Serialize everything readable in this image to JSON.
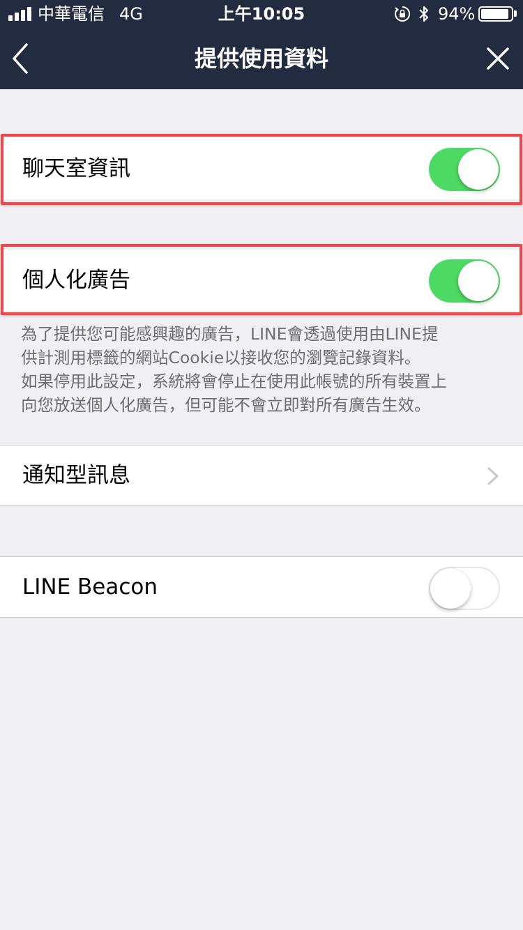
{
  "status_bar": {
    "carrier": "中華電信",
    "network": "4G",
    "time": "上午10:05",
    "battery_percent": "94%",
    "battery_level": 0.94,
    "signal_bars": 4
  },
  "nav": {
    "title": "提供使用資料",
    "back_icon": "chevron-left-icon",
    "close_icon": "close-icon"
  },
  "settings": [
    {
      "label": "聊天室資訊",
      "control": "toggle",
      "on": true,
      "highlighted": true
    },
    {
      "label": "個人化廣告",
      "control": "toggle",
      "on": true,
      "highlighted": true
    },
    {
      "label": "通知型訊息",
      "control": "disclosure"
    },
    {
      "label": "LINE Beacon",
      "control": "toggle",
      "on": false
    }
  ],
  "description": {
    "lines": [
      "為了提供您可能感興趣的廣告，LINE會透過使用由LINE提",
      "供計測用標籤的網站Cookie以接收您的瀏覽記錄資料。",
      "如果停用此設定，系統將會停止在使用此帳號的所有裝置上",
      "向您放送個人化廣告，但可能不會立即對所有廣告生效。"
    ]
  },
  "colors": {
    "header_bg": "#232b41",
    "page_bg": "#efeff4",
    "toggle_on": "#4cd964",
    "highlight": "#f0474b",
    "description_text": "#6d6d72"
  }
}
